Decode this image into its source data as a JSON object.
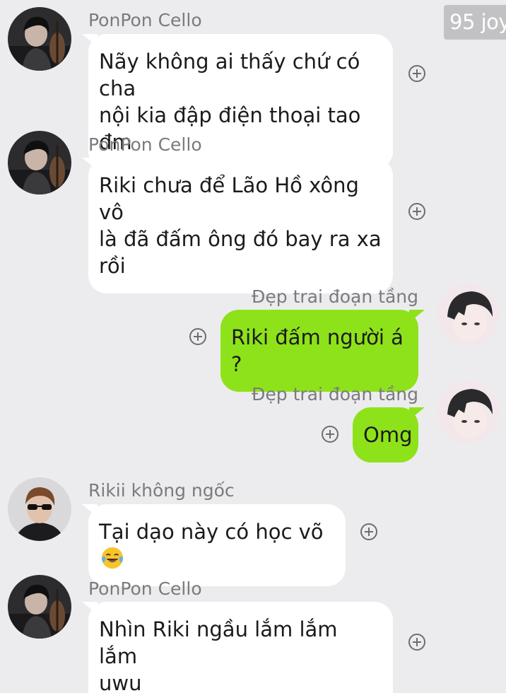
{
  "watermark": "95 joy",
  "messages": [
    {
      "direction": "incoming",
      "sender": "PonPon Cello",
      "avatar": "cello-player-avatar",
      "lines": [
        "Nãy không ai thấy chứ có cha",
        "nội kia đập điện thoại tao đm"
      ]
    },
    {
      "direction": "incoming",
      "sender": "PonPon Cello",
      "avatar": "cello-player-avatar",
      "lines": [
        "Riki chưa để Lão Hồ xông vô",
        "là đã đấm ông đó bay ra xa",
        "rồi"
      ]
    },
    {
      "direction": "outgoing",
      "sender": "Đẹp trai đoạn tầng",
      "avatar": "pale-boy-avatar",
      "lines": [
        "Riki đấm người á ?"
      ]
    },
    {
      "direction": "outgoing",
      "sender": "Đẹp trai đoạn tầng",
      "avatar": "pale-boy-avatar",
      "lines": [
        "Omg"
      ]
    },
    {
      "direction": "incoming",
      "sender": "Rikii không ngốc",
      "avatar": "sunglasses-boy-avatar",
      "lines": [
        "Tại dạo này có học võ"
      ],
      "emoji": "tears-of-joy-emoji"
    },
    {
      "direction": "incoming",
      "sender": "PonPon Cello",
      "avatar": "cello-player-avatar",
      "lines": [
        "Nhìn Riki ngầu lắm lắm lắm",
        "uwu"
      ]
    }
  ],
  "colors": {
    "background": "#ececee",
    "incoming_bubble": "#ffffff",
    "outgoing_bubble": "#8ee21a",
    "sender_text": "#7b7b7e",
    "message_text": "#1b1b1b"
  },
  "icons": {
    "reaction": "add-reaction-icon"
  }
}
